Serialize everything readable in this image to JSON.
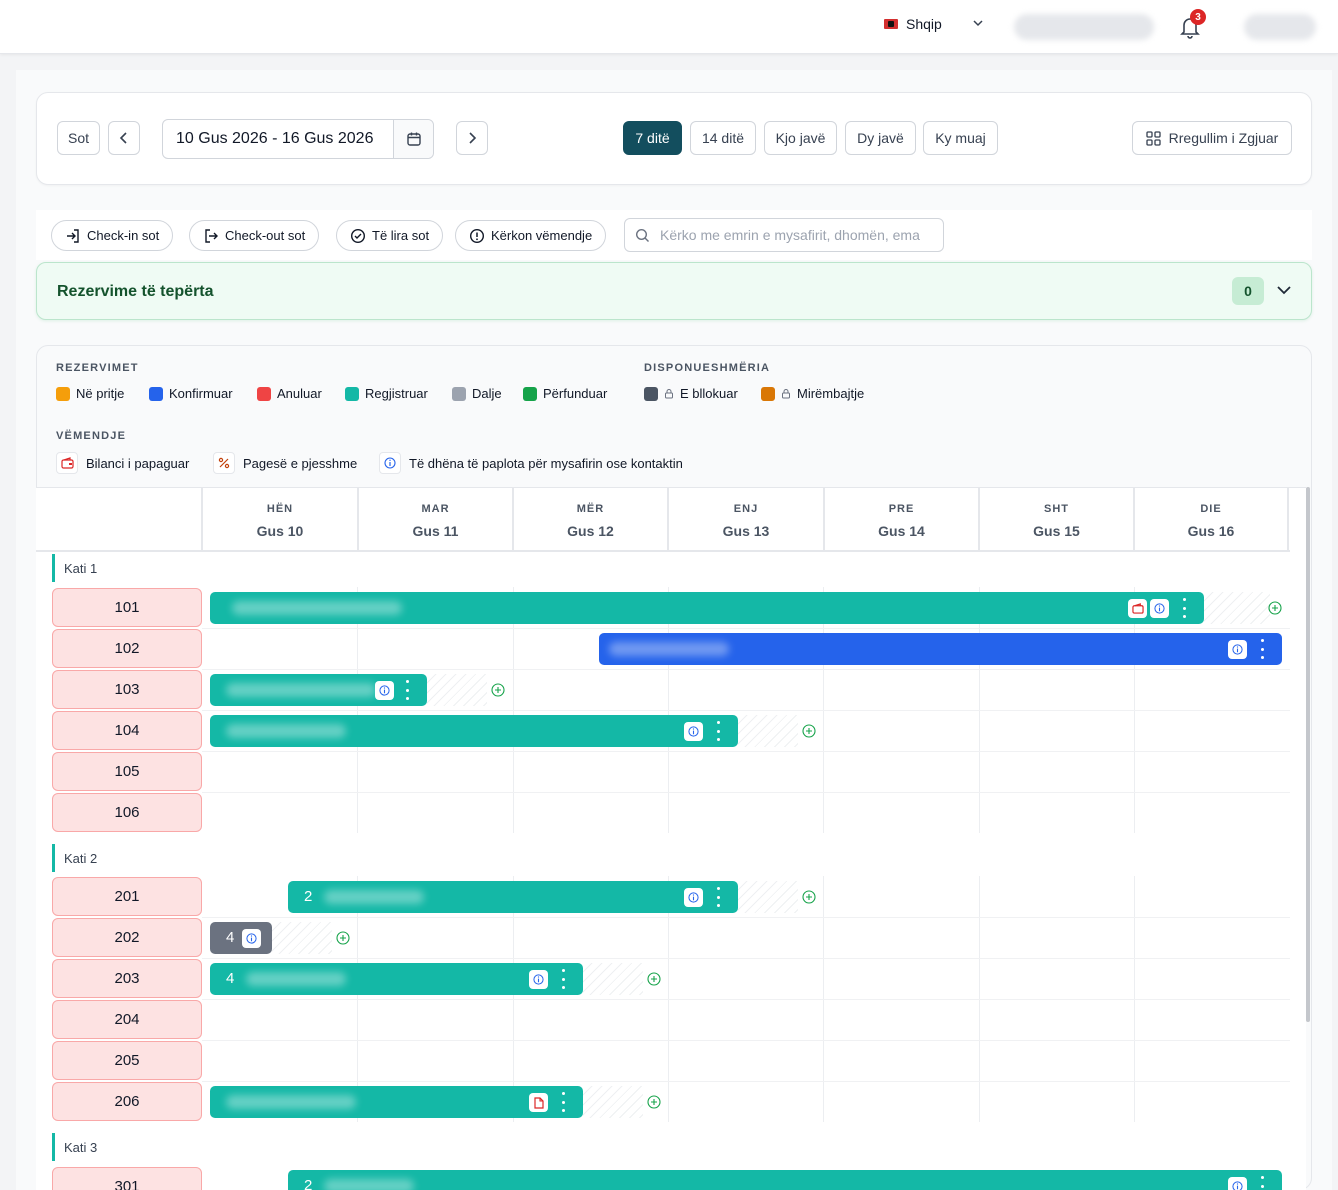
{
  "topbar": {
    "language": "Shqip",
    "notification_count": "3"
  },
  "toolbar": {
    "today_label": "Sot",
    "date_range": "10 Gus 2026 - 16 Gus 2026",
    "views": [
      "7 ditë",
      "14 ditë",
      "Kjo javë",
      "Dy javë",
      "Ky muaj"
    ],
    "active_view": "7 ditë",
    "advanced_settings_label": "Rregullim i Zgjuar"
  },
  "filters": {
    "checkin_today": "Check-in sot",
    "checkout_today": "Check-out sot",
    "free_today": "Të lira sot",
    "needs_attention": "Kërkon vëmendje",
    "search_placeholder": "Kërko me emrin e mysafirit, dhomën, emailin"
  },
  "overbooking": {
    "title": "Rezervime të tepërta",
    "count": "0"
  },
  "legend": {
    "reservations_heading": "REZERVIMET",
    "reservations": [
      {
        "label": "Në pritje",
        "color": "#f59e0b"
      },
      {
        "label": "Konfirmuar",
        "color": "#2563eb"
      },
      {
        "label": "Anuluar",
        "color": "#ef4444"
      },
      {
        "label": "Regjistruar",
        "color": "#14b8a6"
      },
      {
        "label": "Dalje",
        "color": "#9ca3af"
      },
      {
        "label": "Përfunduar",
        "color": "#16a34a"
      }
    ],
    "availability_heading": "DISPONUESHMËRIA",
    "availability": [
      {
        "label": "E bllokuar",
        "color": "#4b5563",
        "icon": "lock-icon"
      },
      {
        "label": "Mirëmbajtje",
        "color": "#d97706",
        "icon": "lock-icon"
      }
    ],
    "attention_heading": "VËMENDJE",
    "attention": [
      {
        "label": "Bilanci i papaguar",
        "icon": "wallet-icon"
      },
      {
        "label": "Pagesë e pjesshme",
        "icon": "percent-icon"
      },
      {
        "label": "Të dhëna të paplota për mysafirin ose kontaktin",
        "icon": "info-icon"
      }
    ]
  },
  "calendar": {
    "days": [
      {
        "dow": "HËN",
        "date": "Gus 10"
      },
      {
        "dow": "MAR",
        "date": "Gus 11"
      },
      {
        "dow": "MËR",
        "date": "Gus 12"
      },
      {
        "dow": "ENJ",
        "date": "Gus 13"
      },
      {
        "dow": "PRE",
        "date": "Gus 14"
      },
      {
        "dow": "SHT",
        "date": "Gus 15"
      },
      {
        "dow": "DIE",
        "date": "Gus 16"
      }
    ],
    "floors": [
      {
        "name": "Kati 1",
        "rooms": [
          "101",
          "102",
          "103",
          "104",
          "105",
          "106"
        ]
      },
      {
        "name": "Kati 2",
        "rooms": [
          "201",
          "202",
          "203",
          "204",
          "205",
          "206"
        ]
      },
      {
        "name": "Kati 3",
        "rooms": [
          "301"
        ]
      }
    ],
    "bookings": [
      {
        "room": "101",
        "status": "Regjistruar",
        "guests": "",
        "icons": [
          "wallet-icon",
          "info-icon"
        ]
      },
      {
        "room": "102",
        "status": "Konfirmuar",
        "guests": "",
        "icons": [
          "info-icon"
        ]
      },
      {
        "room": "103",
        "status": "Regjistruar",
        "guests": "",
        "icons": [
          "info-icon"
        ]
      },
      {
        "room": "104",
        "status": "Regjistruar",
        "guests": "",
        "icons": [
          "info-icon"
        ]
      },
      {
        "room": "201",
        "status": "Regjistruar",
        "guests": "2",
        "icons": [
          "info-icon"
        ]
      },
      {
        "room": "202",
        "status": "Dalje",
        "guests": "4",
        "icons": [
          "info-icon"
        ]
      },
      {
        "room": "203",
        "status": "Regjistruar",
        "guests": "4",
        "icons": [
          "info-icon"
        ]
      },
      {
        "room": "206",
        "status": "Regjistruar",
        "guests": "",
        "icons": [
          "document-icon"
        ]
      },
      {
        "room": "301",
        "status": "Regjistruar",
        "guests": "2",
        "icons": [
          "info-icon"
        ]
      }
    ]
  }
}
